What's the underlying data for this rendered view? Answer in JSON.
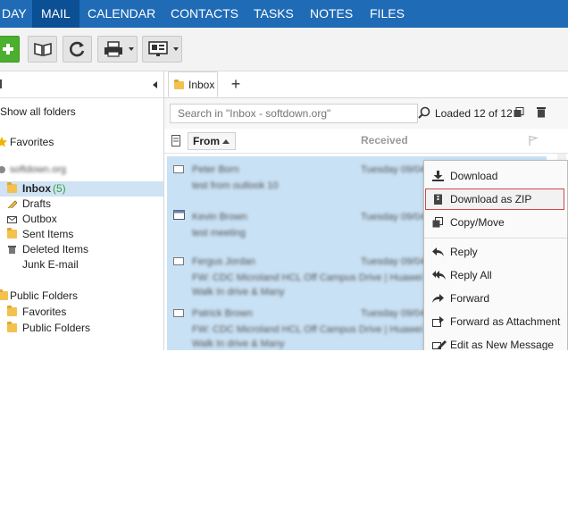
{
  "nav": {
    "tabs": [
      "DAY",
      "MAIL",
      "CALENDAR",
      "CONTACTS",
      "TASKS",
      "NOTES",
      "FILES"
    ],
    "active": "MAIL"
  },
  "colors": {
    "nav_bg": "#1f6bb6",
    "nav_active": "#0b4f95",
    "selection": "#c9e1f4",
    "unread_count": "#35a035",
    "highlight_border": "#d14747"
  },
  "toolbar": {
    "icons": [
      "new-plus-icon",
      "address-book-icon",
      "refresh-icon",
      "print-icon",
      "view-icon"
    ]
  },
  "leftpanel": {
    "show_all": "Show all folders",
    "favorites": "Favorites",
    "account": "softdown.org",
    "folders": [
      "Inbox",
      "Drafts",
      "Outbox",
      "Sent Items",
      "Deleted Items",
      "Junk E-mail"
    ],
    "inbox_count": "(5)",
    "public_folders": "Public Folders",
    "public_children": [
      "Favorites",
      "Public Folders"
    ]
  },
  "tabs": {
    "inbox": "Inbox",
    "add": "+"
  },
  "search": {
    "placeholder": "Search in \"Inbox - softdown.org\"",
    "loaded": "Loaded 12 of 12"
  },
  "columns": {
    "from": "From",
    "received": "Received"
  },
  "messages": [
    {
      "sender": "Peter Born",
      "subject": "test from outlook 10",
      "date": "Tuesday 09/04",
      "extra": ""
    },
    {
      "sender": "Kevin Brown",
      "subject": "test meeting",
      "date": "Tuesday 09/04",
      "extra": ""
    },
    {
      "sender": "Fergus Jordan",
      "subject": "FW: CDC Microland HCL Off Campus Drive | Huawei",
      "date": "Tuesday 09/04",
      "extra": "Walk In drive & Many"
    },
    {
      "sender": "Patrick Brown",
      "subject": "FW: CDC Microland HCL Off Campus Drive | Huawei",
      "date": "Tuesday 09/04",
      "extra": "Walk In drive & Many"
    }
  ],
  "context_menu": {
    "items": [
      "Download",
      "Download as ZIP",
      "Copy/Move",
      "Reply",
      "Reply All",
      "Forward",
      "Forward as Attachment",
      "Edit as New Message"
    ],
    "highlighted": "Download as ZIP"
  }
}
